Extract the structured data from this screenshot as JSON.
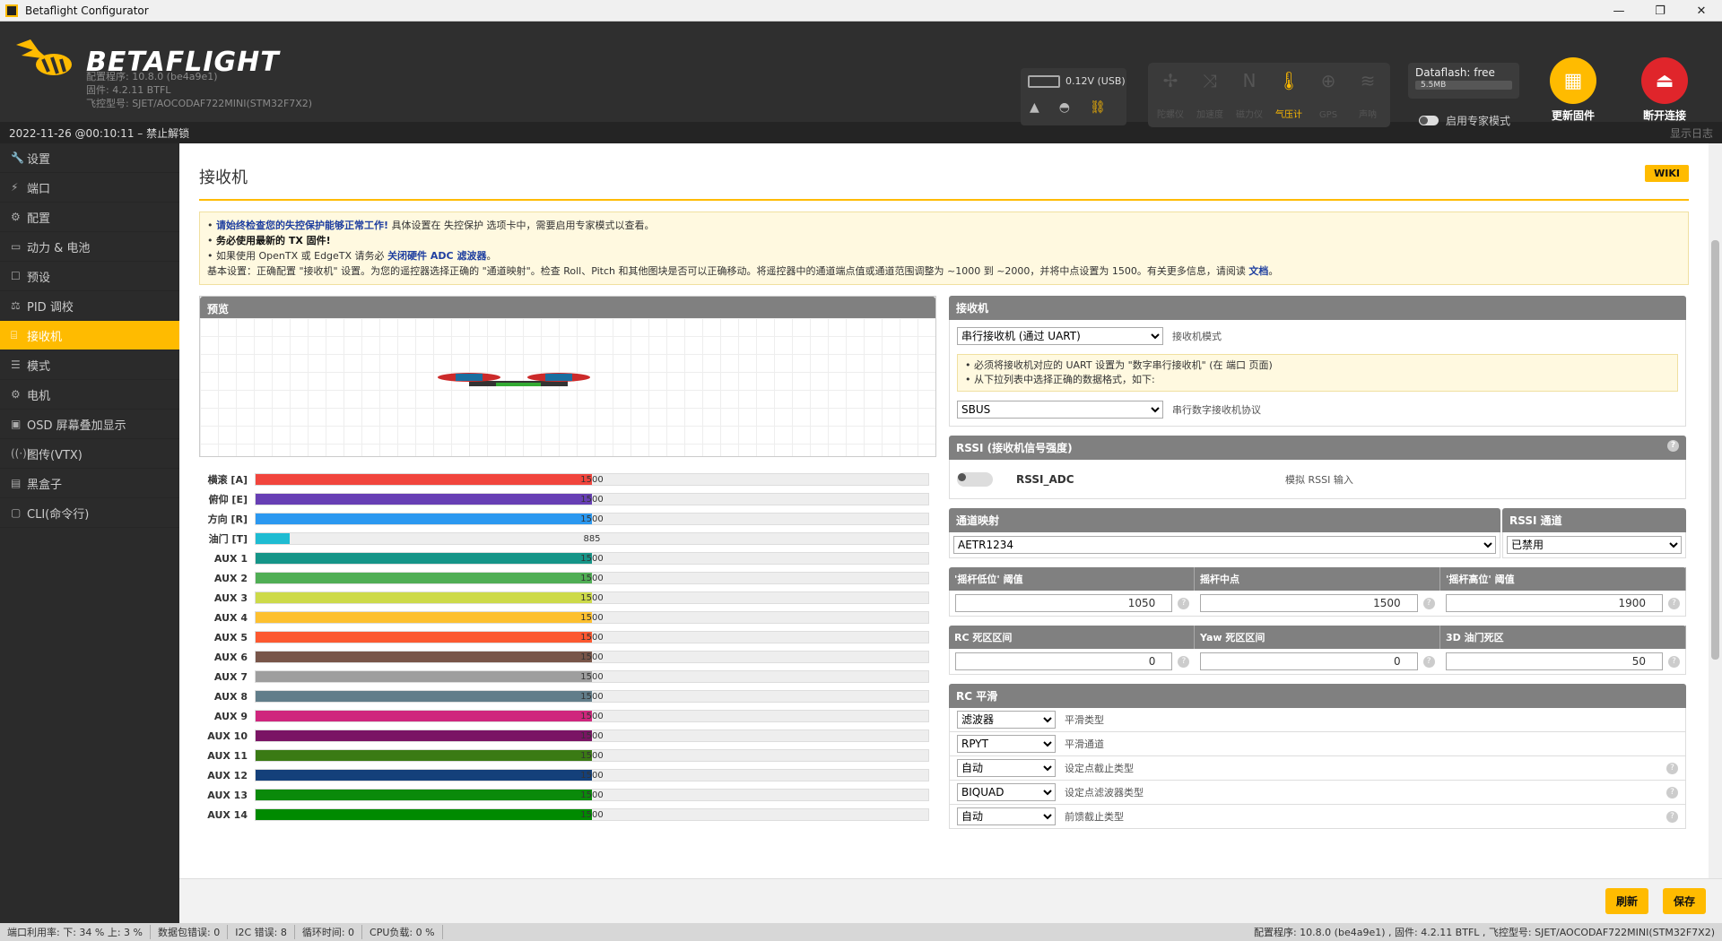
{
  "window": {
    "title": "Betaflight Configurator",
    "btn_min": "—",
    "btn_max": "❐",
    "btn_close": "✕"
  },
  "header": {
    "logo_text": "BETAFLIGHT",
    "configurator_version": "配置程序: 10.8.0 (be4a9e1)",
    "firmware": "固件: 4.2.11 BTFL",
    "board": "飞控型号: SJET/AOCODAF722MINI(STM32F7X2)",
    "battery": "0.12V (USB)",
    "sensors": [
      {
        "label": "陀螺仪",
        "icon": "gyro-icon",
        "glyph": "✢",
        "active": false
      },
      {
        "label": "加速度",
        "icon": "accel-icon",
        "glyph": "⤨",
        "active": false
      },
      {
        "label": "磁力仪",
        "icon": "mag-icon",
        "glyph": "N",
        "active": false
      },
      {
        "label": "气压计",
        "icon": "baro-icon",
        "glyph": "🌡",
        "active": true
      },
      {
        "label": "GPS",
        "icon": "gps-icon",
        "glyph": "⊕",
        "active": false
      },
      {
        "label": "声呐",
        "icon": "sonar-icon",
        "glyph": "≋",
        "active": false
      }
    ],
    "dataflash_title": "Dataflash: free",
    "dataflash_value": "5.5MB",
    "expert_mode": "启用专家模式",
    "update_firmware": "更新固件",
    "disconnect": "断开连接"
  },
  "statusbar": {
    "datetime": "2022-11-26 @00:10:11 – 禁止解锁",
    "show_log": "显示日志"
  },
  "nav": [
    {
      "label": "设置",
      "icon": "wrench-icon",
      "glyph": "🔧",
      "active": false
    },
    {
      "label": "端口",
      "icon": "plug-icon",
      "glyph": "⚡",
      "active": false
    },
    {
      "label": "配置",
      "icon": "gear-icon",
      "glyph": "⚙",
      "active": false
    },
    {
      "label": "动力 & 电池",
      "icon": "battery-icon",
      "glyph": "▭",
      "active": false
    },
    {
      "label": "预设",
      "icon": "preset-icon",
      "glyph": "☐",
      "active": false
    },
    {
      "label": "PID 调校",
      "icon": "pid-icon",
      "glyph": "⚖",
      "active": false
    },
    {
      "label": "接收机",
      "icon": "receiver-icon",
      "glyph": "⌸",
      "active": true
    },
    {
      "label": "模式",
      "icon": "modes-icon",
      "glyph": "☰",
      "active": false
    },
    {
      "label": "电机",
      "icon": "motor-icon",
      "glyph": "⚙",
      "active": false
    },
    {
      "label": "OSD 屏幕叠加显示",
      "icon": "osd-icon",
      "glyph": "▣",
      "active": false
    },
    {
      "label": "图传(VTX)",
      "icon": "vtx-icon",
      "glyph": "((·))",
      "active": false
    },
    {
      "label": "黑盒子",
      "icon": "blackbox-icon",
      "glyph": "▤",
      "active": false
    },
    {
      "label": "CLI(命令行)",
      "icon": "cli-icon",
      "glyph": "▢",
      "active": false
    }
  ],
  "page": {
    "title": "接收机",
    "wiki": "WIKI",
    "note": {
      "line1_bold": "请始终检查您的失控保护能够正常工作!",
      "line1_rest": " 具体设置在 失控保护 选项卡中，需要启用专家模式以查看。",
      "line2": "务必使用最新的 TX 固件!",
      "line3_pre": "如果使用 OpenTX 或 EdgeTX 请务必 ",
      "line3_link": "关闭硬件 ADC 滤波器",
      "line3_post": "。",
      "line4": "基本设置：正确配置 \"接收机\" 设置。为您的遥控器选择正确的 \"通道映射\"。检查 Roll、Pitch 和其他图块是否可以正确移动。将遥控器中的通道端点值或通道范围调整为 ~1000 到 ~2000，并将中点设置为 1500。有关更多信息，请阅读 ",
      "line4_link": "文档",
      "line4_end": "。"
    },
    "preview_title": "预览",
    "channels": [
      {
        "label": "横滚 [A]",
        "value": 1500,
        "color": "#f1453d"
      },
      {
        "label": "俯仰 [E]",
        "value": 1500,
        "color": "#673fb4"
      },
      {
        "label": "方向 [R]",
        "value": 1500,
        "color": "#2b98f0"
      },
      {
        "label": "油门 [T]",
        "value": 885,
        "color": "#1fbcd2"
      },
      {
        "label": "AUX 1",
        "value": 1500,
        "color": "#159588"
      },
      {
        "label": "AUX 2",
        "value": 1500,
        "color": "#50ae55"
      },
      {
        "label": "AUX 3",
        "value": 1500,
        "color": "#cdda49"
      },
      {
        "label": "AUX 4",
        "value": 1500,
        "color": "#fdc02f"
      },
      {
        "label": "AUX 5",
        "value": 1500,
        "color": "#fc5830"
      },
      {
        "label": "AUX 6",
        "value": 1500,
        "color": "#785549"
      },
      {
        "label": "AUX 7",
        "value": 1500,
        "color": "#9e9e9e"
      },
      {
        "label": "AUX 8",
        "value": 1500,
        "color": "#617d8a"
      },
      {
        "label": "AUX 9",
        "value": 1500,
        "color": "#cf267d"
      },
      {
        "label": "AUX 10",
        "value": 1500,
        "color": "#7a1464"
      },
      {
        "label": "AUX 11",
        "value": 1500,
        "color": "#3a7a14"
      },
      {
        "label": "AUX 12",
        "value": 1500,
        "color": "#14407a"
      },
      {
        "label": "AUX 13",
        "value": 1500,
        "color": "#0a8a0a"
      },
      {
        "label": "AUX 14",
        "value": 1500,
        "color": "#008a00"
      }
    ],
    "receiver": {
      "title": "接收机",
      "mode_value": "串行接收机 (通过 UART)",
      "mode_label": "接收机模式",
      "warn1": "• 必须将接收机对应的 UART 设置为 \"数字串行接收机\" (在 端口 页面)",
      "warn2": "• 从下拉列表中选择正确的数据格式，如下:",
      "protocol_value": "SBUS",
      "protocol_label": "串行数字接收机协议"
    },
    "rssi": {
      "title": "RSSI (接收机信号强度)",
      "name": "RSSI_ADC",
      "desc": "模拟 RSSI 输入"
    },
    "channel_map": {
      "title": "通道映射",
      "value": "AETR1234",
      "rssi_channel_title": "RSSI 通道",
      "rssi_channel_value": "已禁用"
    },
    "stick": {
      "low_title": "'摇杆低位' 阈值",
      "low": "1050",
      "center_title": "摇杆中点",
      "center": "1500",
      "high_title": "'摇杆高位' 阈值",
      "high": "1900"
    },
    "deadband": {
      "rc_title": "RC 死区区间",
      "rc": "0",
      "yaw_title": "Yaw 死区区间",
      "yaw": "0",
      "throttle3d_title": "3D 油门死区",
      "throttle3d": "50"
    },
    "smoothing": {
      "title": "RC 平滑",
      "rows": [
        {
          "value": "滤波器",
          "label": "平滑类型",
          "help": false
        },
        {
          "value": "RPYT",
          "label": "平滑通道",
          "help": false
        },
        {
          "value": "自动",
          "label": "设定点截止类型",
          "help": true
        },
        {
          "value": "BIQUAD",
          "label": "设定点滤波器类型",
          "help": true
        },
        {
          "value": "自动",
          "label": "前馈截止类型",
          "help": true
        }
      ]
    },
    "refresh": "刷新",
    "save": "保存"
  },
  "footer": {
    "port_util": "端口利用率:   下: 34 %  上: 3 %",
    "packet_errors": "数据包错误: 0",
    "i2c_errors": "I2C 错误: 8",
    "cycle_time": "循环时间: 0",
    "cpu_load": "CPU负载: 0 %",
    "version_info": "配置程序: 10.8.0 (be4a9e1) , 固件: 4.2.11 BTFL , 飞控型号: SJET/AOCODAF722MINI(STM32F7X2)"
  },
  "colors": {
    "accent": "#ffbb00",
    "sidebar": "#2b2b2b",
    "panel_head": "#808080",
    "update_btn": "#ffbb00",
    "disconnect_btn": "#e0252b"
  }
}
